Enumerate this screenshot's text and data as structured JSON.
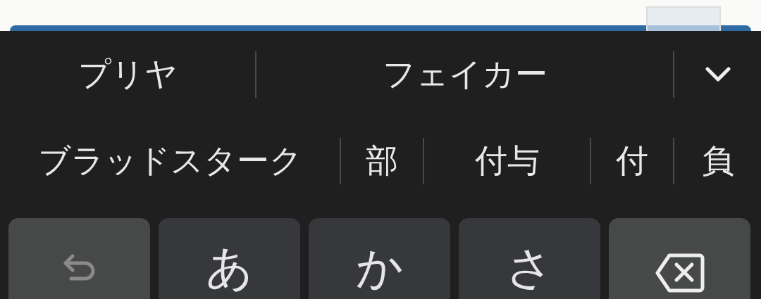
{
  "suggestions": [
    {
      "text": "プリヤ"
    },
    {
      "text": "フェイカー"
    }
  ],
  "expand_button": {
    "expanded": false
  },
  "candidates": [
    {
      "text": "ブラッドスターク"
    },
    {
      "text": "部"
    },
    {
      "text": "付与"
    },
    {
      "text": "付"
    },
    {
      "text": "負"
    }
  ],
  "keys": [
    {
      "kind": "undo",
      "disabled": true
    },
    {
      "kind": "char",
      "label": "あ"
    },
    {
      "kind": "char",
      "label": "か"
    },
    {
      "kind": "char",
      "label": "さ"
    },
    {
      "kind": "backspace"
    }
  ]
}
